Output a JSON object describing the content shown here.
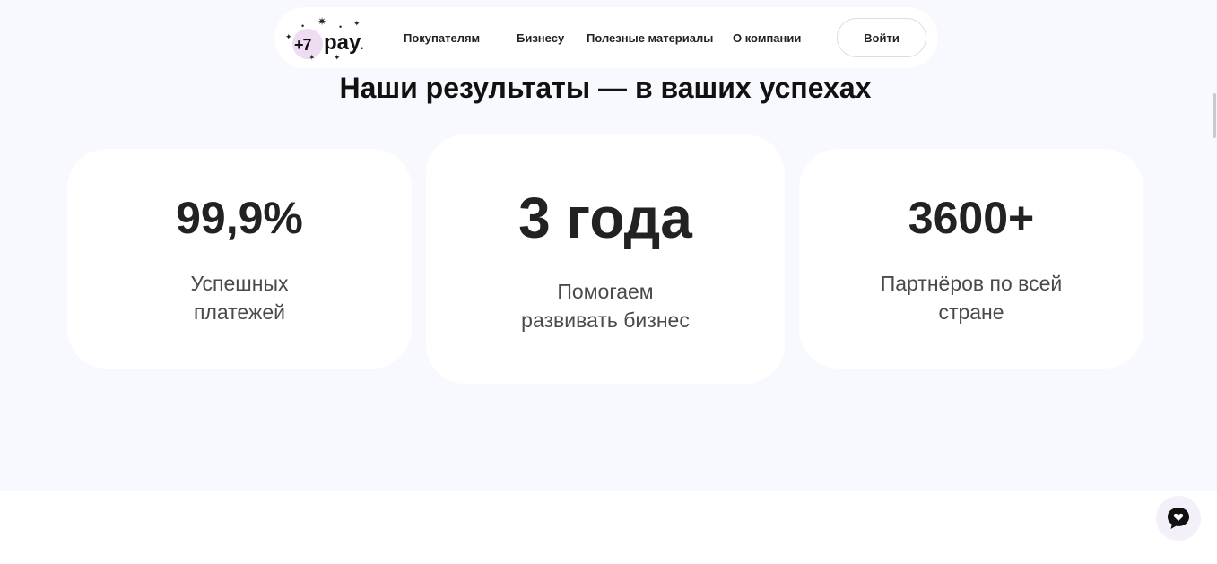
{
  "nav": {
    "logo": {
      "prefix": "+7",
      "wordmark": "pay"
    },
    "links": [
      "Покупателям",
      "Бизнесу",
      "Полезные материалы",
      "О компании"
    ],
    "login_label": "Войти"
  },
  "section": {
    "title": "Наши результаты — в ваших успехах",
    "stats": [
      {
        "value": "99,9%",
        "desc_lines": [
          "Успешных",
          "платежей"
        ]
      },
      {
        "value": "3 года",
        "desc_lines": [
          "Помогаем",
          "развивать бизнес"
        ]
      },
      {
        "value": "3600+",
        "desc_lines": [
          "Партнёров по всей",
          "стране"
        ]
      }
    ]
  },
  "chat": {
    "icon": "chat-heart-icon"
  },
  "colors": {
    "section_bg": "#f8f9fe",
    "card_bg": "#ffffff",
    "text_dark": "#222222",
    "text_muted": "#4a4a4a",
    "logo_bubble": "#eedcf2"
  }
}
